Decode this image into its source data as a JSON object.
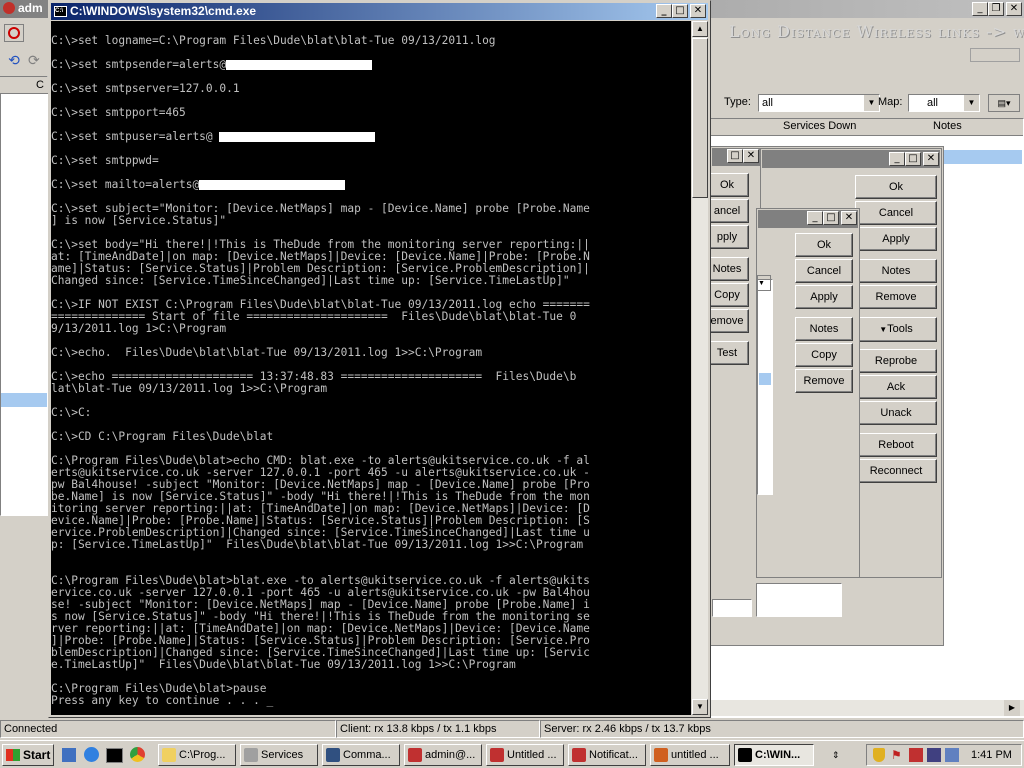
{
  "cmd": {
    "title": "C:\\WINDOWS\\system32\\cmd.exe",
    "lines": [
      {
        "t": "",
        "y": 0
      },
      {
        "t": "C:\\>set logname=C:\\Program Files\\Dude\\blat\\blat-Tue 09/13/2011.log"
      },
      {
        "t": ""
      },
      {
        "t": "C:\\>set smtpsender=alerts@",
        "redact": 146
      },
      {
        "t": ""
      },
      {
        "t": "C:\\>set smtpserver=127.0.0.1"
      },
      {
        "t": ""
      },
      {
        "t": "C:\\>set smtpport=465"
      },
      {
        "t": ""
      },
      {
        "t": "C:\\>set smtpuser=alerts@ ",
        "redact": 156
      },
      {
        "t": ""
      },
      {
        "t": "C:\\>set smtppwd="
      },
      {
        "t": ""
      },
      {
        "t": "C:\\>set mailto=alerts@",
        "redact": 146
      },
      {
        "t": ""
      },
      {
        "t": "C:\\>set subject=\"Monitor: [Device.NetMaps] map - [Device.Name] probe [Probe.Name"
      },
      {
        "t": "] is now [Service.Status]\""
      },
      {
        "t": ""
      },
      {
        "t": "C:\\>set body=\"Hi there!|!This is TheDude from the monitoring server reporting:||"
      },
      {
        "t": "at: [TimeAndDate]|on map: [Device.NetMaps]|Device: [Device.Name]|Probe: [Probe.N"
      },
      {
        "t": "ame]|Status: [Service.Status]|Problem Description: [Service.ProblemDescription]|"
      },
      {
        "t": "Changed since: [Service.TimeSinceChanged]|Last time up: [Service.TimeLastUp]\""
      },
      {
        "t": ""
      },
      {
        "t": "C:\\>IF NOT EXIST C:\\Program Files\\Dude\\blat\\blat-Tue 09/13/2011.log echo ======="
      },
      {
        "t": "============== Start of file =====================  Files\\Dude\\blat\\blat-Tue 0"
      },
      {
        "t": "9/13/2011.log 1>C:\\Program"
      },
      {
        "t": ""
      },
      {
        "t": "C:\\>echo.  Files\\Dude\\blat\\blat-Tue 09/13/2011.log 1>>C:\\Program"
      },
      {
        "t": ""
      },
      {
        "t": "C:\\>echo ===================== 13:37:48.83 =====================  Files\\Dude\\b"
      },
      {
        "t": "lat\\blat-Tue 09/13/2011.log 1>>C:\\Program"
      },
      {
        "t": ""
      },
      {
        "t": "C:\\>C:"
      },
      {
        "t": ""
      },
      {
        "t": "C:\\>CD C:\\Program Files\\Dude\\blat"
      },
      {
        "t": ""
      },
      {
        "t": "C:\\Program Files\\Dude\\blat>echo CMD: blat.exe -to alerts@ukitservice.co.uk -f al"
      },
      {
        "t": "erts@ukitservice.co.uk -server 127.0.0.1 -port 465 -u alerts@ukitservice.co.uk -"
      },
      {
        "t": "pw Bal4house! -subject \"Monitor: [Device.NetMaps] map - [Device.Name] probe [Pro"
      },
      {
        "t": "be.Name] is now [Service.Status]\" -body \"Hi there!|!This is TheDude from the mon"
      },
      {
        "t": "itoring server reporting:||at: [TimeAndDate]|on map: [Device.NetMaps]|Device: [D"
      },
      {
        "t": "evice.Name]|Probe: [Probe.Name]|Status: [Service.Status]|Problem Description: [S"
      },
      {
        "t": "ervice.ProblemDescription]|Changed since: [Service.TimeSinceChanged]|Last time u"
      },
      {
        "t": "p: [Service.TimeLastUp]\"  Files\\Dude\\blat\\blat-Tue 09/13/2011.log 1>>C:\\Program"
      },
      {
        "t": ""
      },
      {
        "t": ""
      },
      {
        "t": "C:\\Program Files\\Dude\\blat>blat.exe -to alerts@ukitservice.co.uk -f alerts@ukits"
      },
      {
        "t": "ervice.co.uk -server 127.0.0.1 -port 465 -u alerts@ukitservice.co.uk -pw Bal4hou"
      },
      {
        "t": "se! -subject \"Monitor: [Device.NetMaps] map - [Device.Name] probe [Probe.Name] i"
      },
      {
        "t": "s now [Service.Status]\" -body \"Hi there!|!This is TheDude from the monitoring se"
      },
      {
        "t": "rver reporting:||at: [TimeAndDate]|on map: [Device.NetMaps]|Device: [Device.Name"
      },
      {
        "t": "]|Probe: [Probe.Name]|Status: [Service.Status]|Problem Description: [Service.Pro"
      },
      {
        "t": "blemDescription]|Changed since: [Service.TimeSinceChanged]|Last time up: [Servic"
      },
      {
        "t": "e.TimeLastUp]\"  Files\\Dude\\blat\\blat-Tue 09/13/2011.log 1>>C:\\Program"
      },
      {
        "t": ""
      },
      {
        "t": "C:\\Program Files\\Dude\\blat>pause"
      },
      {
        "t": "Press any key to continue . . . _"
      }
    ]
  },
  "dude": {
    "title_fragment": "adm",
    "banner": "Long Distance Wireless links -> www",
    "type_label": "Type:",
    "type_value": "all",
    "map_label": "Map:",
    "map_value": "all",
    "col_services_down": "Services Down",
    "col_notes": "Notes",
    "col_c": "C",
    "status_connected": "Connected",
    "status_client": "Client: rx 13.8 kbps / tx 1.1 kbps",
    "status_server": "Server: rx 2.46 kbps / tx 13.7 kbps"
  },
  "dialog1": {
    "buttons": [
      "Ok",
      "ancel",
      "pply",
      "Notes",
      "Copy",
      "emove",
      "Test"
    ]
  },
  "dialog2": {
    "buttons": [
      "Ok",
      "Cancel",
      "Apply",
      "Notes",
      "Copy",
      "Remove"
    ]
  },
  "dialog3": {
    "buttons": [
      "Ok",
      "Cancel",
      "Apply",
      "Notes",
      "Remove",
      "Tools",
      "Reprobe",
      "Ack",
      "Unack",
      "Reboot",
      "Reconnect"
    ]
  },
  "taskbar": {
    "start": "Start",
    "tasks": [
      "C:\\Prog...",
      "Services",
      "Comma...",
      "admin@...",
      "Untitled ...",
      "Notificat...",
      "untitled ...",
      "C:\\WIN..."
    ],
    "clock": "1:41 PM"
  },
  "colors": {
    "title_active": "#0a246a",
    "title_inactive": "#808080",
    "console_text": "#c0c0c0"
  }
}
